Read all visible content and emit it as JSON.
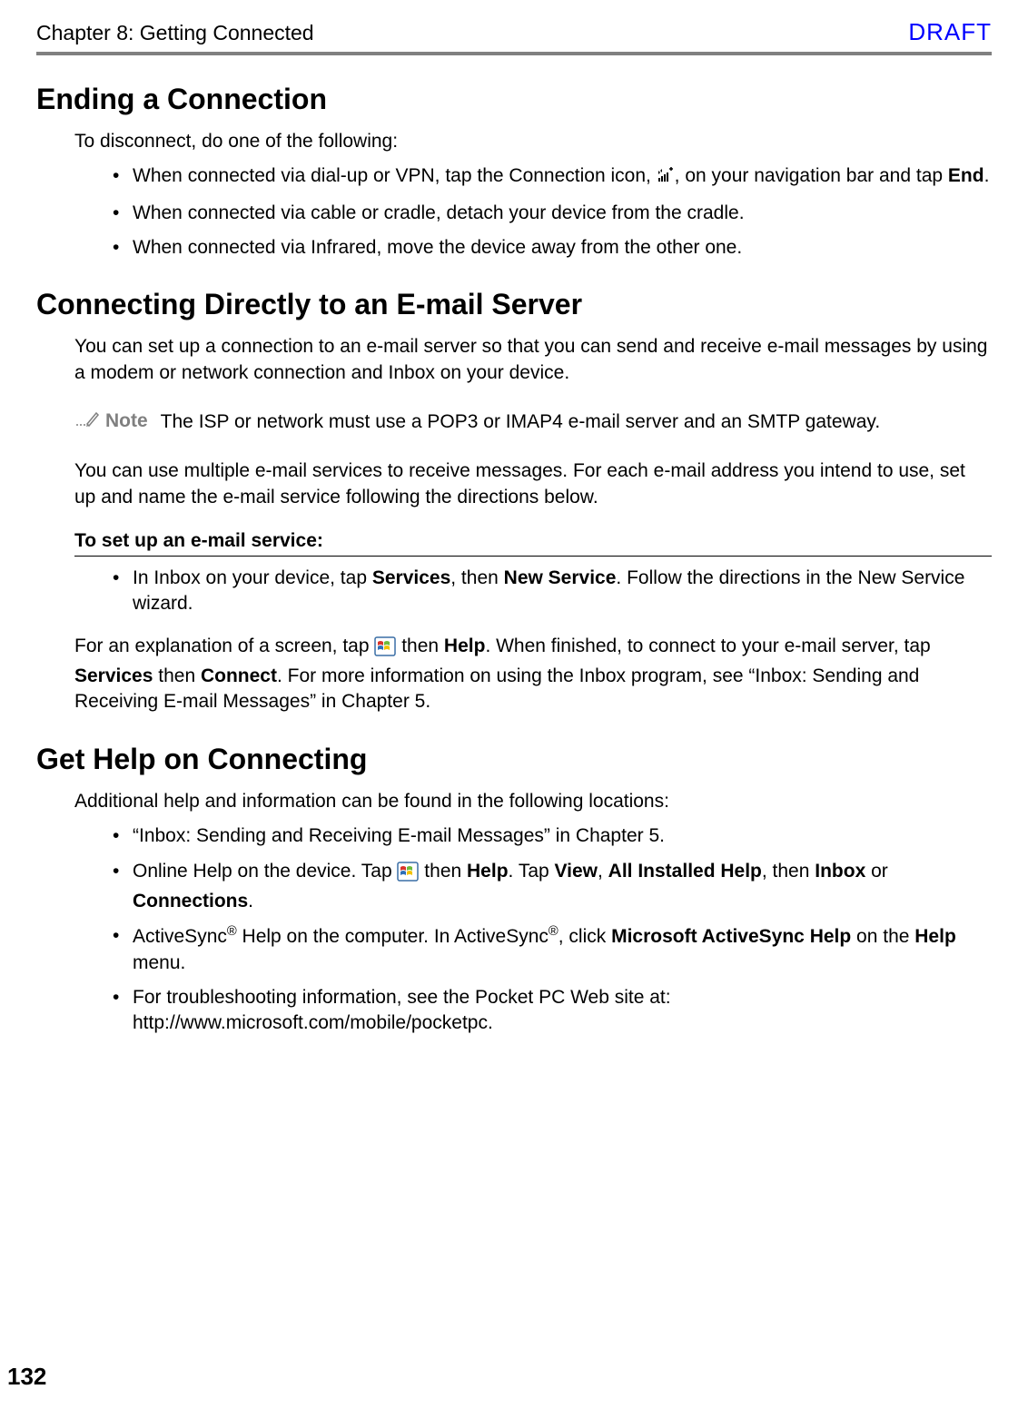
{
  "header": {
    "chapter": "Chapter 8: Getting Connected",
    "draft": "DRAFT"
  },
  "section1": {
    "title": "Ending a Connection",
    "intro": "To disconnect, do one of the following:",
    "bullets": [
      {
        "pre": "When connected via dial-up or VPN, tap the Connection icon, ",
        "post": ", on your navigation bar and tap ",
        "bold": "End",
        "tail": "."
      },
      {
        "text": "When connected via cable or cradle, detach your device from the cradle."
      },
      {
        "text": "When connected via Infrared, move the device away from the other one."
      }
    ]
  },
  "section2": {
    "title": "Connecting Directly to an E-mail Server",
    "p1": "You can set up a connection to an e-mail server so that you can send and receive e-mail messages by using a modem or network connection and Inbox on your device.",
    "note_label": "Note",
    "note_text": "The ISP or network must use a POP3 or IMAP4 e-mail server and an SMTP gateway.",
    "p2": "You can use multiple e-mail services to receive messages. For each e-mail address you intend to use, set up and name the e-mail service following the directions below.",
    "subhead": "To set up an e-mail service:",
    "bullet": {
      "pre": "In Inbox on your device, tap ",
      "b1": "Services",
      "mid1": ", then ",
      "b2": "New Service",
      "post": ". Follow the directions in the New Service wizard."
    },
    "p3": {
      "t1": "For an explanation of a screen, tap ",
      "t2": " then ",
      "b1": "Help",
      "t3": ". When finished, to connect to your e-mail server, tap ",
      "b2": "Services",
      "t4": " then ",
      "b3": "Connect",
      "t5": ". For more information on using the Inbox program, see “Inbox: Sending and Receiving E-mail Messages” in Chapter 5."
    }
  },
  "section3": {
    "title": "Get Help on Connecting",
    "intro": "Additional help and information can be found in the following locations:",
    "bullets": {
      "b1": "“Inbox: Sending and Receiving E-mail Messages” in Chapter 5.",
      "b2": {
        "t1": "Online Help on the device. Tap ",
        "t2": " then ",
        "w1": "Help",
        "t3": ". Tap ",
        "w2": "View",
        "t4": ", ",
        "w3": "All Installed Help",
        "t5": ", then ",
        "w4": "Inbox",
        "t6": " or ",
        "w5": "Connections",
        "t7": "."
      },
      "b3": {
        "t1": "ActiveSync",
        "sup": "®",
        "t2": " Help on the computer. In ActiveSync",
        "t3": ", click ",
        "w1": "Microsoft ActiveSync Help",
        "t4": " on the ",
        "w2": "Help",
        "t5": " menu."
      },
      "b4": "For troubleshooting information, see the Pocket PC Web site at: http://www.microsoft.com/mobile/pocketpc."
    }
  },
  "page_number": "132"
}
